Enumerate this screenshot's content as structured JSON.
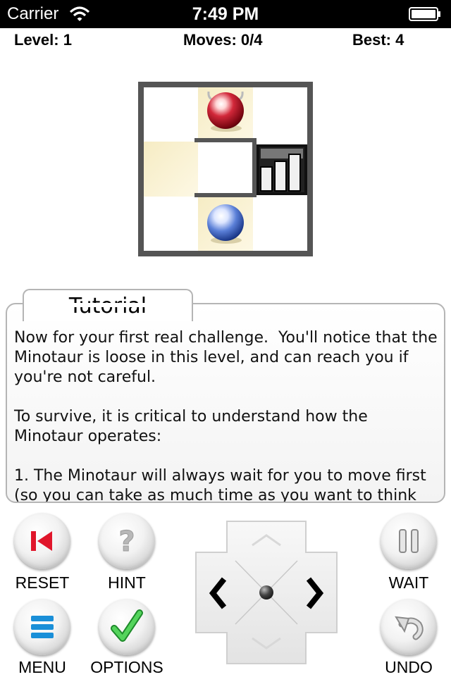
{
  "status_bar": {
    "carrier": "Carrier",
    "time": "7:49 PM",
    "icons": [
      "wifi-icon",
      "battery-icon"
    ]
  },
  "stats": {
    "level": "Level: 1",
    "moves": "Moves: 0/4",
    "best": "Best: 4"
  },
  "board": {
    "grid_size": 3,
    "pieces": [
      "minotaur",
      "theseus",
      "exit"
    ],
    "colors": {
      "highlight": "#f7eecb",
      "wall": "#555555",
      "minotaur": "#c8142a",
      "theseus": "#2a55c0"
    }
  },
  "tutorial": {
    "title": "Tutorial",
    "body": "Now for your first real challenge.  You'll notice that the Minotaur is loose in this level, and can reach you if you're not careful.\n\nTo survive, it is critical to understand how the Minotaur operates:\n\n1. The Minotaur will always wait for you to move first (so you can take as much time as you want to think"
  },
  "controls": {
    "reset": "RESET",
    "hint": "HINT",
    "menu": "MENU",
    "options": "OPTIONS",
    "wait": "WAIT",
    "undo": "UNDO"
  },
  "dpad": {
    "directions": [
      "up",
      "down",
      "left",
      "right"
    ]
  }
}
